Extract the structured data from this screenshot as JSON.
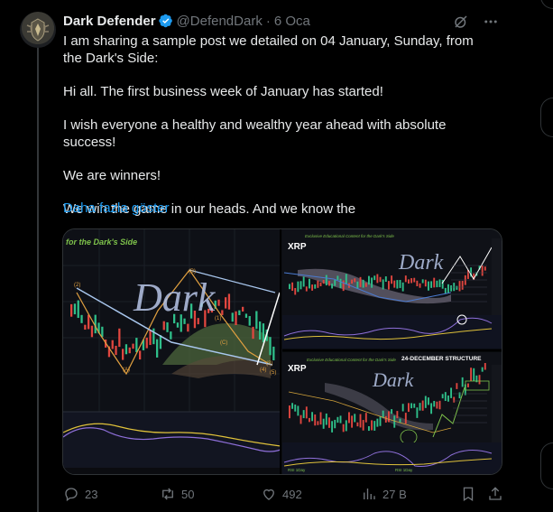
{
  "tweet": {
    "author_name": "Dark Defender",
    "handle": "@DefendDark",
    "separator": "·",
    "time": "6 Oca",
    "lines": [
      "I am sharing a sample post we detailed on 04 January, Sunday, from the Dark's Side:",
      "Hi all. The first business week of January has started!",
      "I wish everyone a healthy and wealthy year ahead with absolute success!",
      "We are winners!",
      "We win the game in our heads. And we know the"
    ],
    "show_more": "Daha fazla göster"
  },
  "media": {
    "left_panel": {
      "header": "for the Dark's Side",
      "watermark": "Dark",
      "wave_labels": [
        "(A)",
        "(B)",
        "(C)",
        "(2)",
        "(1)",
        "(3)",
        "(4)",
        "(5)"
      ]
    },
    "top_right_panel": {
      "caption": "Exclusive Educational Content for the Dark's Side",
      "logo": "XRP",
      "watermark": "Dark"
    },
    "bottom_right_panel": {
      "caption": "Exclusive Educational Content for the Dark's Side",
      "title": "24-DECEMBER STRUCTURE",
      "logo": "XRP",
      "watermark": "Dark",
      "footer_labels": [
        "RSI 1Day",
        "RSI 1Day"
      ]
    }
  },
  "actions": {
    "replies": "23",
    "reposts": "50",
    "likes": "492",
    "views": "27 B"
  },
  "colors": {
    "accent": "#1d9bf0",
    "muted": "#71767b",
    "text": "#e7e9ea",
    "background": "#000000",
    "verified": "#1d9bf0",
    "border": "#2f3336"
  }
}
